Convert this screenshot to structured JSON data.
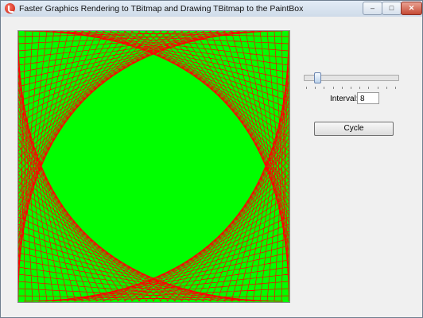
{
  "window": {
    "title": "Faster Graphics Rendering to TBitmap and Drawing TBitmap to the PaintBox",
    "colors": {
      "paint_background": "#00ff00",
      "paint_lines": "#ff0000"
    }
  },
  "controls": {
    "slider": {
      "value_fraction": 0.13,
      "tick_count": 11
    },
    "interval_label": "Interval:",
    "interval_value": "8",
    "cycle_label": "Cycle"
  }
}
